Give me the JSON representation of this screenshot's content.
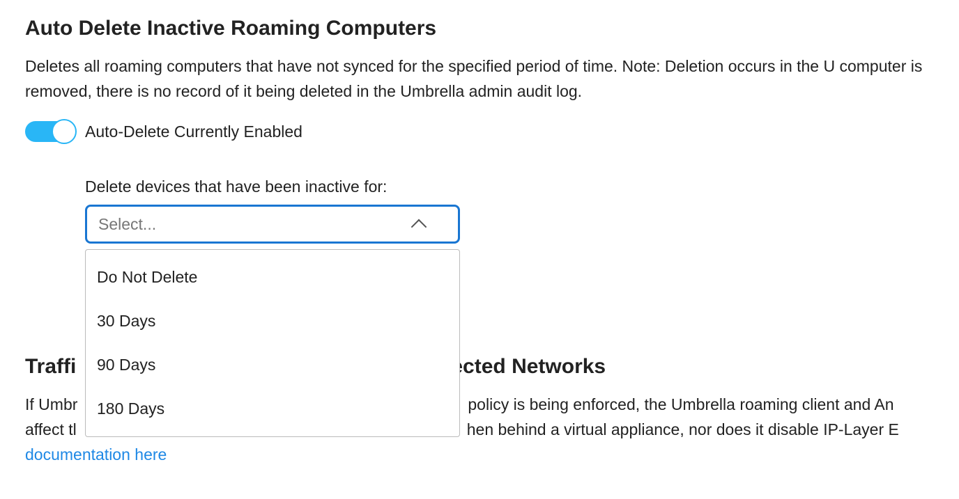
{
  "section1": {
    "title": "Auto Delete Inactive Roaming Computers",
    "description": "Deletes all roaming computers that have not synced for the specified period of time. Note: Deletion occurs in the U computer is removed, there is no record of it being deleted in the Umbrella admin audit log.",
    "toggle_label": "Auto-Delete Currently Enabled",
    "field_label": "Delete devices that have been inactive for:",
    "select_placeholder": "Select...",
    "options": [
      "Do Not Delete",
      "30 Days",
      "90 Days",
      "180 Days"
    ]
  },
  "section2": {
    "title_part1": "Traffi",
    "title_part2": "ected Networks",
    "desc_part1": "If Umbr",
    "desc_part2": "policy is being enforced, the Umbrella roaming client and An",
    "desc_part3": "affect tl",
    "desc_part4": "hen behind a virtual appliance, nor does it disable IP-Layer E",
    "doc_link_text": "documentation here"
  }
}
